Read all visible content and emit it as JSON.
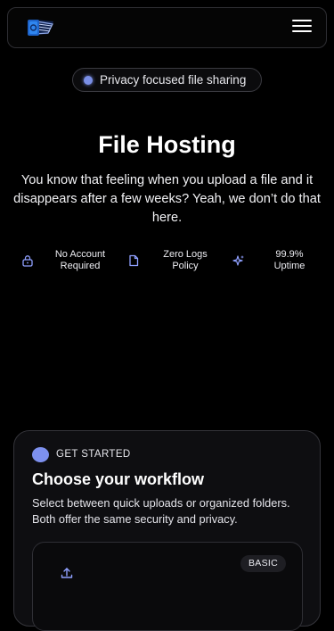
{
  "nav": {
    "logo_icon": "folder-document-icon",
    "menu_icon": "hamburger-menu-icon"
  },
  "badge": {
    "label": "Privacy focused file sharing",
    "dot_color": "#7a8fe6"
  },
  "hero": {
    "title": "File Hosting",
    "description": "You know that feeling when you upload a file and it disappears after a few weeks? Yeah, we don’t do that here."
  },
  "features": [
    {
      "icon": "lock-icon",
      "label": "No Account Required"
    },
    {
      "icon": "document-icon",
      "label": "Zero Logs Policy"
    },
    {
      "icon": "sparkle-icon",
      "label": "99.9% Uptime"
    }
  ],
  "workflow": {
    "eyebrow": "GET STARTED",
    "title": "Choose your workflow",
    "description": "Select between quick uploads or organized folders. Both offer the same security and privacy.",
    "option": {
      "icon": "upload-icon",
      "badge": "BASIC"
    }
  },
  "colors": {
    "accent": "#7d90ee",
    "icon_accent": "#8fa0ff",
    "background": "#000000"
  }
}
